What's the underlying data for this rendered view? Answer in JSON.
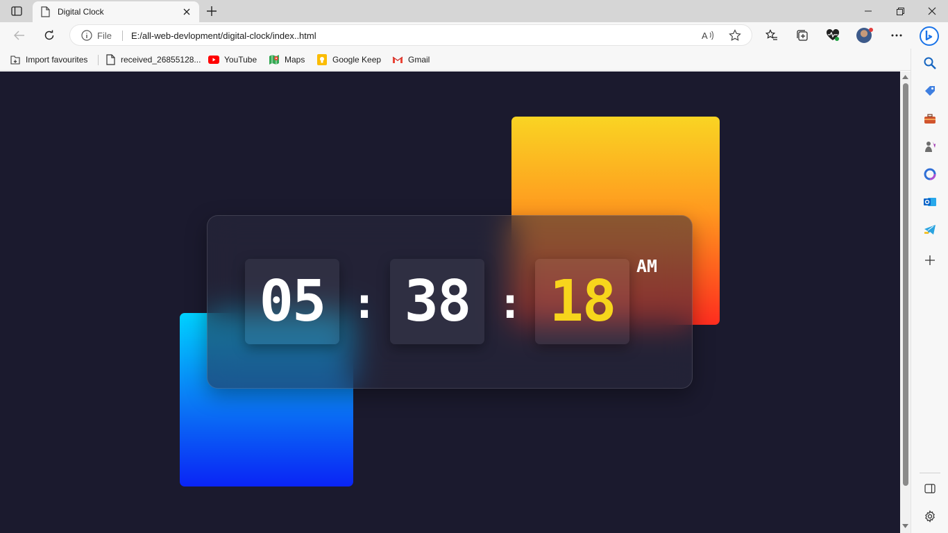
{
  "tab": {
    "title": "Digital Clock"
  },
  "toolbar": {
    "site_info_label": "File",
    "url": "E:/all-web-devlopment/digital-clock/index..html"
  },
  "bookmarks": [
    {
      "label": "Import favourites",
      "icon": "import-icon"
    },
    {
      "label": "received_26855128...",
      "icon": "file-icon"
    },
    {
      "label": "YouTube",
      "icon": "youtube-icon",
      "color": "#ff0000"
    },
    {
      "label": "Maps",
      "icon": "maps-icon"
    },
    {
      "label": "Google Keep",
      "icon": "keep-icon",
      "color": "#fbbc04"
    },
    {
      "label": "Gmail",
      "icon": "gmail-icon"
    }
  ],
  "sidebar": {
    "items": [
      "search-icon",
      "shopping-tag-icon",
      "toolbox-icon",
      "games-icon",
      "office-icon",
      "outlook-icon",
      "telegram-icon",
      "add-icon",
      "split-screen-icon",
      "settings-icon"
    ]
  },
  "clock": {
    "hours": "05",
    "minutes": "38",
    "seconds": "18",
    "separator": ":",
    "period": "AM"
  },
  "colors": {
    "background": "#1b1a2e",
    "seconds": "#f7d51c",
    "orange_gradient": [
      "#f9d423",
      "#ff2d1f"
    ],
    "blue_gradient": [
      "#00d2ff",
      "#0a24f5"
    ]
  }
}
